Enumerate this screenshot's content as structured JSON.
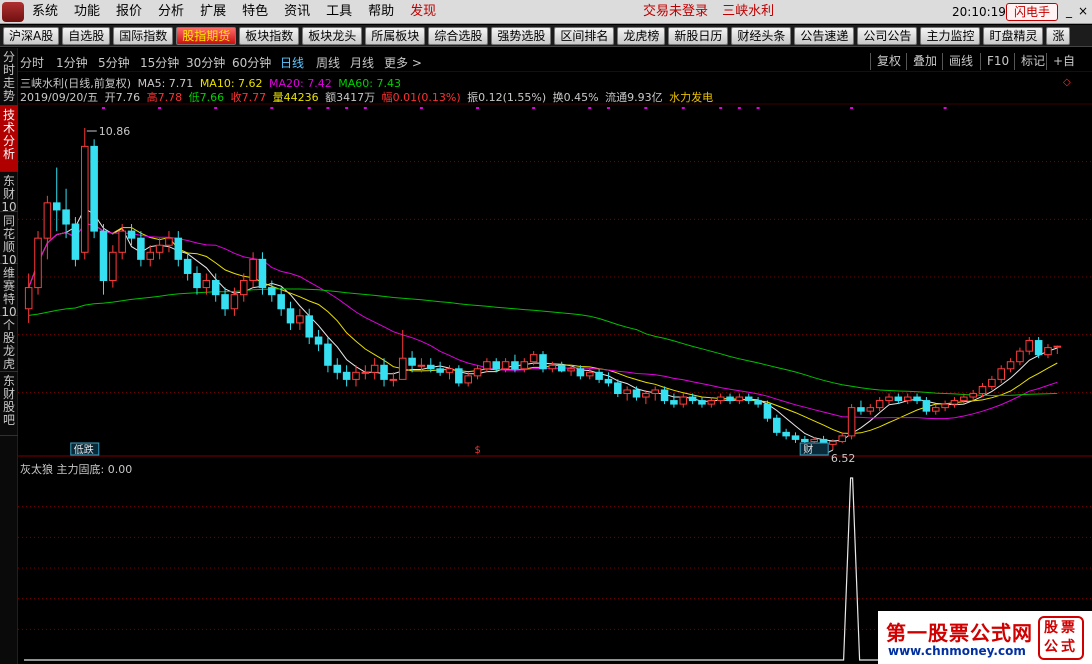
{
  "menu": {
    "items": [
      "系统",
      "功能",
      "报价",
      "分析",
      "扩展",
      "特色",
      "资讯",
      "工具",
      "帮助"
    ],
    "discover": "发现",
    "login_status": "交易未登录",
    "stock_title": "三峡水利",
    "clock": "20:10:19 周五",
    "flash_button": "闪电手"
  },
  "toolbar": {
    "buttons": [
      "沪深A股",
      "自选股",
      "国际指数",
      "股指期货",
      "板块指数",
      "板块龙头",
      "所属板块",
      "综合选股",
      "强势选股",
      "区间排名",
      "龙虎榜",
      "新股日历",
      "财经头条",
      "公告速递",
      "公司公告",
      "主力监控",
      "盯盘精灵",
      "涨"
    ],
    "active_index": 3
  },
  "left_tabs": [
    {
      "label": "分时走势",
      "active": false
    },
    {
      "label": "技术分析",
      "active": true
    },
    {
      "label": "东财10",
      "active": false
    },
    {
      "label": "同花顺10",
      "active": false
    },
    {
      "label": "维赛特10",
      "active": false
    },
    {
      "label": "个股龙虎",
      "active": false
    },
    {
      "label": "东财股吧",
      "active": false
    }
  ],
  "periods": [
    "分时",
    "1分钟",
    "5分钟",
    "15分钟",
    "30分钟",
    "60分钟",
    "日线",
    "周线",
    "月线",
    "更多 >"
  ],
  "active_period": "日线",
  "right_buttons": [
    "复权",
    "叠加",
    "画线",
    "F10",
    "标记",
    "+自"
  ],
  "info": {
    "name": "三峡水利(日线,前复权)",
    "ma5": "MA5: 7.71",
    "ma10": "MA10: 7.62",
    "ma20": "MA20: 7.42",
    "ma60": "MA60: 7.43",
    "date": "2019/09/20/五",
    "open": "开7.76",
    "high": "高7.78",
    "low": "低7.66",
    "close": "收7.77",
    "volume": "量44236",
    "amount": "额3417万",
    "change": "幅0.01(0.13%)",
    "amplitude": "振0.12(1.55%)",
    "turnover": "换0.45%",
    "float": "流通9.93亿",
    "sector": "水力发电"
  },
  "markers": {
    "high_label": "10.86",
    "low_label": "6.52",
    "tag_left": "低跌",
    "tag_mid": "$",
    "tag_right": "财"
  },
  "sub_indicator": {
    "name": "灰太狼",
    "line": "主力固底: 0.00"
  },
  "watermark": {
    "title": "第一股票公式网",
    "url": "www.chnmoney.com",
    "seal": "股票公式"
  },
  "colors": {
    "up": "#ff3b3b",
    "down": "#36e0f0",
    "ma5": "#e8e8e8",
    "ma10": "#e8e000",
    "ma20": "#e000e0",
    "ma60": "#00c000",
    "grid": "#7a0000"
  },
  "chart_data": {
    "type": "candlestick",
    "y_range": [
      6.3,
      11.2
    ],
    "candles": [
      {
        "o": 8.3,
        "h": 8.8,
        "l": 8.1,
        "c": 8.6
      },
      {
        "o": 8.6,
        "h": 9.4,
        "l": 8.5,
        "c": 9.3
      },
      {
        "o": 9.3,
        "h": 9.9,
        "l": 9.0,
        "c": 9.8
      },
      {
        "o": 9.8,
        "h": 10.3,
        "l": 9.4,
        "c": 9.7
      },
      {
        "o": 9.7,
        "h": 10.0,
        "l": 9.3,
        "c": 9.5
      },
      {
        "o": 9.5,
        "h": 9.6,
        "l": 8.9,
        "c": 9.0
      },
      {
        "o": 9.1,
        "h": 10.86,
        "l": 9.0,
        "c": 10.6
      },
      {
        "o": 10.6,
        "h": 10.7,
        "l": 9.3,
        "c": 9.4
      },
      {
        "o": 9.4,
        "h": 9.5,
        "l": 8.5,
        "c": 8.7
      },
      {
        "o": 8.7,
        "h": 9.2,
        "l": 8.6,
        "c": 9.1
      },
      {
        "o": 9.1,
        "h": 9.5,
        "l": 9.0,
        "c": 9.4
      },
      {
        "o": 9.4,
        "h": 9.5,
        "l": 9.2,
        "c": 9.3
      },
      {
        "o": 9.3,
        "h": 9.4,
        "l": 8.9,
        "c": 9.0
      },
      {
        "o": 9.0,
        "h": 9.2,
        "l": 8.9,
        "c": 9.1
      },
      {
        "o": 9.1,
        "h": 9.3,
        "l": 9.0,
        "c": 9.2
      },
      {
        "o": 9.2,
        "h": 9.4,
        "l": 9.1,
        "c": 9.3
      },
      {
        "o": 9.3,
        "h": 9.4,
        "l": 8.9,
        "c": 9.0
      },
      {
        "o": 9.0,
        "h": 9.1,
        "l": 8.7,
        "c": 8.8
      },
      {
        "o": 8.8,
        "h": 8.9,
        "l": 8.5,
        "c": 8.6
      },
      {
        "o": 8.6,
        "h": 8.8,
        "l": 8.5,
        "c": 8.7
      },
      {
        "o": 8.7,
        "h": 8.8,
        "l": 8.4,
        "c": 8.5
      },
      {
        "o": 8.5,
        "h": 8.6,
        "l": 8.2,
        "c": 8.3
      },
      {
        "o": 8.3,
        "h": 8.6,
        "l": 8.2,
        "c": 8.5
      },
      {
        "o": 8.5,
        "h": 8.8,
        "l": 8.4,
        "c": 8.7
      },
      {
        "o": 8.7,
        "h": 9.1,
        "l": 8.6,
        "c": 9.0
      },
      {
        "o": 9.0,
        "h": 9.1,
        "l": 8.5,
        "c": 8.6
      },
      {
        "o": 8.6,
        "h": 8.7,
        "l": 8.4,
        "c": 8.5
      },
      {
        "o": 8.5,
        "h": 8.6,
        "l": 8.2,
        "c": 8.3
      },
      {
        "o": 8.3,
        "h": 8.4,
        "l": 8.0,
        "c": 8.1
      },
      {
        "o": 8.1,
        "h": 8.3,
        "l": 8.0,
        "c": 8.2
      },
      {
        "o": 8.2,
        "h": 8.3,
        "l": 7.8,
        "c": 7.9
      },
      {
        "o": 7.9,
        "h": 8.0,
        "l": 7.7,
        "c": 7.8
      },
      {
        "o": 7.8,
        "h": 7.9,
        "l": 7.4,
        "c": 7.5
      },
      {
        "o": 7.5,
        "h": 7.6,
        "l": 7.3,
        "c": 7.4
      },
      {
        "o": 7.4,
        "h": 7.5,
        "l": 7.2,
        "c": 7.3
      },
      {
        "o": 7.3,
        "h": 7.5,
        "l": 7.2,
        "c": 7.4
      },
      {
        "o": 7.4,
        "h": 7.5,
        "l": 7.3,
        "c": 7.4
      },
      {
        "o": 7.4,
        "h": 7.6,
        "l": 7.3,
        "c": 7.5
      },
      {
        "o": 7.5,
        "h": 7.6,
        "l": 7.2,
        "c": 7.3
      },
      {
        "o": 7.3,
        "h": 7.4,
        "l": 7.2,
        "c": 7.3
      },
      {
        "o": 7.3,
        "h": 8.0,
        "l": 7.3,
        "c": 7.6
      },
      {
        "o": 7.6,
        "h": 7.7,
        "l": 7.4,
        "c": 7.5
      },
      {
        "o": 7.5,
        "h": 7.6,
        "l": 7.4,
        "c": 7.5
      },
      {
        "o": 7.5,
        "h": 7.6,
        "l": 7.4,
        "c": 7.45
      },
      {
        "o": 7.45,
        "h": 7.55,
        "l": 7.35,
        "c": 7.4
      },
      {
        "o": 7.4,
        "h": 7.5,
        "l": 7.3,
        "c": 7.45
      },
      {
        "o": 7.45,
        "h": 7.5,
        "l": 7.2,
        "c": 7.25
      },
      {
        "o": 7.25,
        "h": 7.4,
        "l": 7.2,
        "c": 7.35
      },
      {
        "o": 7.35,
        "h": 7.5,
        "l": 7.3,
        "c": 7.45
      },
      {
        "o": 7.45,
        "h": 7.6,
        "l": 7.4,
        "c": 7.55
      },
      {
        "o": 7.55,
        "h": 7.6,
        "l": 7.4,
        "c": 7.45
      },
      {
        "o": 7.45,
        "h": 7.6,
        "l": 7.4,
        "c": 7.55
      },
      {
        "o": 7.55,
        "h": 7.65,
        "l": 7.4,
        "c": 7.45
      },
      {
        "o": 7.45,
        "h": 7.6,
        "l": 7.4,
        "c": 7.55
      },
      {
        "o": 7.55,
        "h": 7.7,
        "l": 7.5,
        "c": 7.65
      },
      {
        "o": 7.65,
        "h": 7.7,
        "l": 7.4,
        "c": 7.45
      },
      {
        "o": 7.45,
        "h": 7.55,
        "l": 7.4,
        "c": 7.5
      },
      {
        "o": 7.5,
        "h": 7.55,
        "l": 7.4,
        "c": 7.42
      },
      {
        "o": 7.42,
        "h": 7.5,
        "l": 7.35,
        "c": 7.45
      },
      {
        "o": 7.45,
        "h": 7.5,
        "l": 7.3,
        "c": 7.35
      },
      {
        "o": 7.35,
        "h": 7.45,
        "l": 7.3,
        "c": 7.4
      },
      {
        "o": 7.4,
        "h": 7.45,
        "l": 7.25,
        "c": 7.3
      },
      {
        "o": 7.3,
        "h": 7.4,
        "l": 7.2,
        "c": 7.25
      },
      {
        "o": 7.25,
        "h": 7.3,
        "l": 7.05,
        "c": 7.1
      },
      {
        "o": 7.1,
        "h": 7.2,
        "l": 7.0,
        "c": 7.15
      },
      {
        "o": 7.15,
        "h": 7.2,
        "l": 7.0,
        "c": 7.05
      },
      {
        "o": 7.05,
        "h": 7.15,
        "l": 6.95,
        "c": 7.1
      },
      {
        "o": 7.1,
        "h": 7.2,
        "l": 7.0,
        "c": 7.15
      },
      {
        "o": 7.15,
        "h": 7.2,
        "l": 6.95,
        "c": 7.0
      },
      {
        "o": 7.0,
        "h": 7.1,
        "l": 6.9,
        "c": 6.95
      },
      {
        "o": 6.95,
        "h": 7.1,
        "l": 6.9,
        "c": 7.05
      },
      {
        "o": 7.05,
        "h": 7.1,
        "l": 6.95,
        "c": 7.0
      },
      {
        "o": 7.0,
        "h": 7.05,
        "l": 6.9,
        "c": 6.95
      },
      {
        "o": 6.95,
        "h": 7.05,
        "l": 6.9,
        "c": 7.0
      },
      {
        "o": 7.0,
        "h": 7.1,
        "l": 6.95,
        "c": 7.05
      },
      {
        "o": 7.05,
        "h": 7.1,
        "l": 6.95,
        "c": 7.0
      },
      {
        "o": 7.0,
        "h": 7.1,
        "l": 6.95,
        "c": 7.05
      },
      {
        "o": 7.05,
        "h": 7.1,
        "l": 6.95,
        "c": 7.0
      },
      {
        "o": 7.0,
        "h": 7.05,
        "l": 6.9,
        "c": 6.95
      },
      {
        "o": 6.95,
        "h": 7.0,
        "l": 6.7,
        "c": 6.75
      },
      {
        "o": 6.75,
        "h": 6.8,
        "l": 6.5,
        "c": 6.55
      },
      {
        "o": 6.55,
        "h": 6.6,
        "l": 6.45,
        "c": 6.5
      },
      {
        "o": 6.5,
        "h": 6.55,
        "l": 6.4,
        "c": 6.45
      },
      {
        "o": 6.45,
        "h": 6.5,
        "l": 6.4,
        "c": 6.42
      },
      {
        "o": 6.42,
        "h": 6.48,
        "l": 6.38,
        "c": 6.45
      },
      {
        "o": 6.45,
        "h": 6.5,
        "l": 6.35,
        "c": 6.4
      },
      {
        "o": 6.38,
        "h": 6.45,
        "l": 6.3,
        "c": 6.42
      },
      {
        "o": 6.42,
        "h": 6.55,
        "l": 6.4,
        "c": 6.5
      },
      {
        "o": 6.5,
        "h": 6.95,
        "l": 6.45,
        "c": 6.9
      },
      {
        "o": 6.9,
        "h": 7.0,
        "l": 6.8,
        "c": 6.85
      },
      {
        "o": 6.85,
        "h": 6.95,
        "l": 6.8,
        "c": 6.9
      },
      {
        "o": 6.9,
        "h": 7.05,
        "l": 6.85,
        "c": 7.0
      },
      {
        "o": 7.0,
        "h": 7.1,
        "l": 6.95,
        "c": 7.05
      },
      {
        "o": 7.05,
        "h": 7.1,
        "l": 6.95,
        "c": 7.0
      },
      {
        "o": 7.0,
        "h": 7.1,
        "l": 6.95,
        "c": 7.05
      },
      {
        "o": 7.05,
        "h": 7.1,
        "l": 6.95,
        "c": 7.0
      },
      {
        "o": 7.0,
        "h": 7.05,
        "l": 6.8,
        "c": 6.85
      },
      {
        "o": 6.85,
        "h": 6.95,
        "l": 6.8,
        "c": 6.9
      },
      {
        "o": 6.9,
        "h": 7.0,
        "l": 6.85,
        "c": 6.95
      },
      {
        "o": 6.95,
        "h": 7.05,
        "l": 6.9,
        "c": 7.0
      },
      {
        "o": 7.0,
        "h": 7.1,
        "l": 6.95,
        "c": 7.05
      },
      {
        "o": 7.05,
        "h": 7.15,
        "l": 7.0,
        "c": 7.1
      },
      {
        "o": 7.1,
        "h": 7.25,
        "l": 7.05,
        "c": 7.2
      },
      {
        "o": 7.2,
        "h": 7.35,
        "l": 7.15,
        "c": 7.3
      },
      {
        "o": 7.3,
        "h": 7.5,
        "l": 7.25,
        "c": 7.45
      },
      {
        "o": 7.45,
        "h": 7.6,
        "l": 7.4,
        "c": 7.55
      },
      {
        "o": 7.55,
        "h": 7.75,
        "l": 7.5,
        "c": 7.7
      },
      {
        "o": 7.7,
        "h": 7.9,
        "l": 7.65,
        "c": 7.85
      },
      {
        "o": 7.85,
        "h": 7.9,
        "l": 7.6,
        "c": 7.65
      },
      {
        "o": 7.65,
        "h": 7.8,
        "l": 7.6,
        "c": 7.75
      },
      {
        "o": 7.76,
        "h": 7.78,
        "l": 7.66,
        "c": 7.77
      }
    ],
    "sub_spike_index": 88,
    "sub_y_range": [
      0,
      1
    ]
  }
}
